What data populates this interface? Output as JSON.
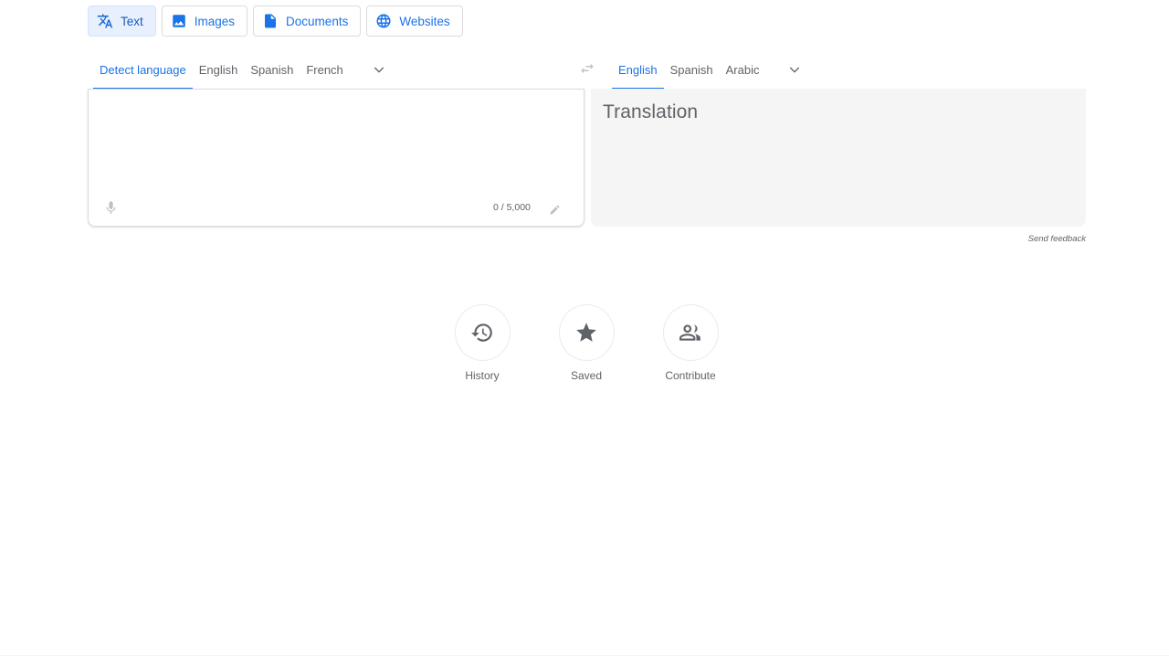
{
  "mode_tabs": [
    {
      "label": "Text",
      "icon": "translate-icon",
      "active": true
    },
    {
      "label": "Images",
      "icon": "image-icon",
      "active": false
    },
    {
      "label": "Documents",
      "icon": "document-icon",
      "active": false
    },
    {
      "label": "Websites",
      "icon": "globe-icon",
      "active": false
    }
  ],
  "source_languages": [
    "Detect language",
    "English",
    "Spanish",
    "French"
  ],
  "source_active": "Detect language",
  "target_languages": [
    "English",
    "Spanish",
    "Arabic"
  ],
  "target_active": "English",
  "source_panel": {
    "input_value": "",
    "char_count": "0 / 5,000"
  },
  "target_panel": {
    "placeholder": "Translation"
  },
  "send_feedback": "Send feedback",
  "quick_actions": [
    {
      "label": "History",
      "icon": "history-icon"
    },
    {
      "label": "Saved",
      "icon": "star-icon"
    },
    {
      "label": "Contribute",
      "icon": "people-icon"
    }
  ],
  "colors": {
    "accent": "#1a73e8",
    "active_tab_bg": "#e8f0fe",
    "target_panel_bg": "#f5f5f5",
    "muted_text": "#5f6368"
  }
}
